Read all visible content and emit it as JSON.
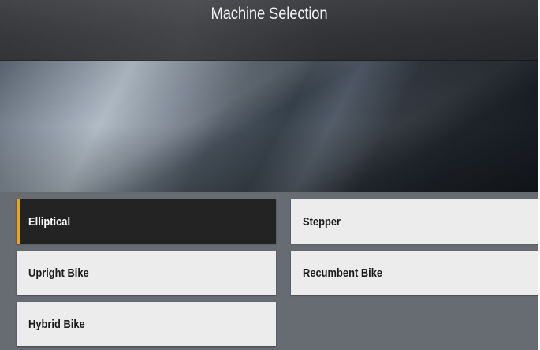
{
  "header": {
    "title": "Machine Selection"
  },
  "banner": {
    "image": "decorative-metallic-banner"
  },
  "machines": [
    {
      "label": "Elliptical",
      "selected": true
    },
    {
      "label": "Stepper",
      "selected": false
    },
    {
      "label": "Upright Bike",
      "selected": false
    },
    {
      "label": "Recumbent Bike",
      "selected": false
    },
    {
      "label": "Hybrid Bike",
      "selected": false
    }
  ],
  "colors": {
    "background": "#676c73",
    "header": "#2e3033",
    "tile": "#ececec",
    "tile_selected": "#232323",
    "accent": "#f2a40f"
  }
}
